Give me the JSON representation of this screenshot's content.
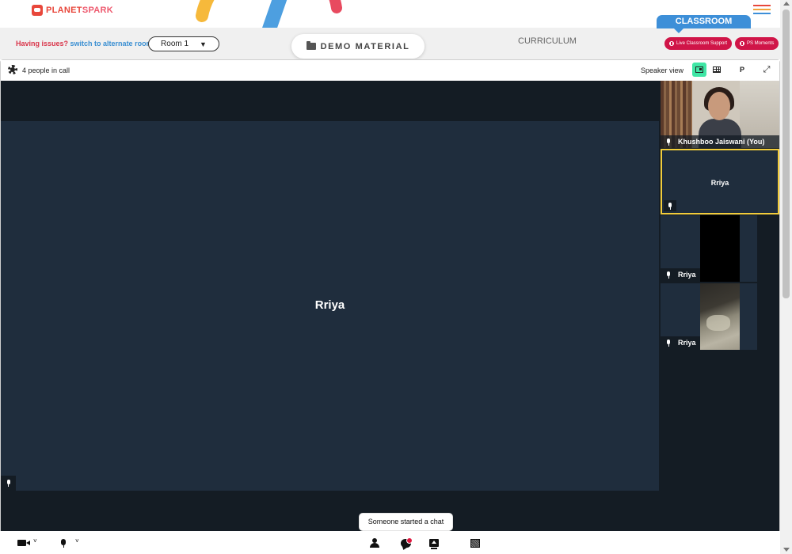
{
  "brand": {
    "logo_text_a": "PLANET",
    "logo_text_b": "SPARK"
  },
  "header": {
    "classroom_tab": "CLASSROOM",
    "issues_text": "Having issues?",
    "alternate_room_link": "switch to alternate room",
    "room_select": {
      "value": "Room 1"
    },
    "demo_material": "DEMO MATERIAL",
    "curriculum": "CURRICULUM",
    "live_support": "Live Classroom Support",
    "ps_moments": "PS Moments",
    "hamburger_colors": [
      "#e8473b",
      "#f2a33a",
      "#3d8fd8"
    ]
  },
  "call": {
    "people_count": "4 people in call",
    "view_label": "Speaker view",
    "p_button": "P"
  },
  "stage": {
    "speaker_name": "Rriya"
  },
  "participants": [
    {
      "name": "Khushboo Jaiswani (You)",
      "state": "video"
    },
    {
      "name": "Rriya",
      "state": "active-speaker"
    },
    {
      "name": "Rriya",
      "state": "video-dark"
    },
    {
      "name": "Rriya",
      "state": "video"
    }
  ],
  "toast": {
    "text": "Someone started a chat"
  },
  "colors": {
    "accent_green": "#3fe6a5",
    "active_border": "#f2cc3b",
    "stage_bg": "#1f2d3d",
    "support_pill": "#d01548",
    "classroom_blue": "#3d8fd8"
  }
}
